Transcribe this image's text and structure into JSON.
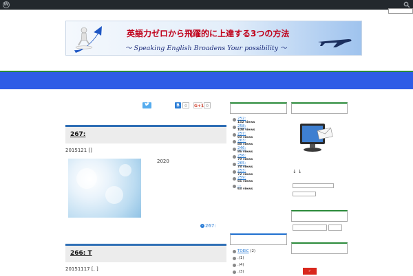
{
  "admin_bar": {
    "logo": "wordpress-icon",
    "search": "search-icon"
  },
  "banner": {
    "title": "英語力ゼロから飛躍的に上達する3つの方法",
    "subtitle": "～ Speaking English Broadens Your possibility ～"
  },
  "share": {
    "hatena_count": "0",
    "gplus_label": "G+1",
    "gplus_count": "0"
  },
  "posts": [
    {
      "title": "267:",
      "meta": "2015121 []",
      "excerpt": "2020",
      "more": "267:"
    },
    {
      "title": "266: T",
      "meta": "20151117 [, ]"
    }
  ],
  "popular": [
    {
      "title": "252:",
      "views": "152 views"
    },
    {
      "title": "258:",
      "views": "108 views"
    },
    {
      "title": "257:",
      "views": "93 views"
    },
    {
      "title": "263:",
      "views": "88 views"
    },
    {
      "title": "246:",
      "views": "86 views"
    },
    {
      "title": "256:",
      "views": "79 views"
    },
    {
      "title": "265:",
      "views": "78 views"
    },
    {
      "title": "253:",
      "views": "72 views"
    },
    {
      "title": "259:",
      "views": "66 views"
    },
    {
      "title": "…",
      "views": "63 views"
    }
  ],
  "categories": [
    {
      "name": "TOEIC",
      "count": "(2)"
    },
    {
      "name": "",
      "count": ".(1)"
    },
    {
      "name": "",
      "count": ".(4)"
    },
    {
      "name": "",
      "count": ".(3)"
    }
  ],
  "right_sidebar": {
    "arrows": "↓↓"
  },
  "colors": {
    "nav": "#2e5ce6",
    "accent_green": "#2a8a3a",
    "link": "#2a7dd6",
    "admin_bar": "#23282d"
  }
}
